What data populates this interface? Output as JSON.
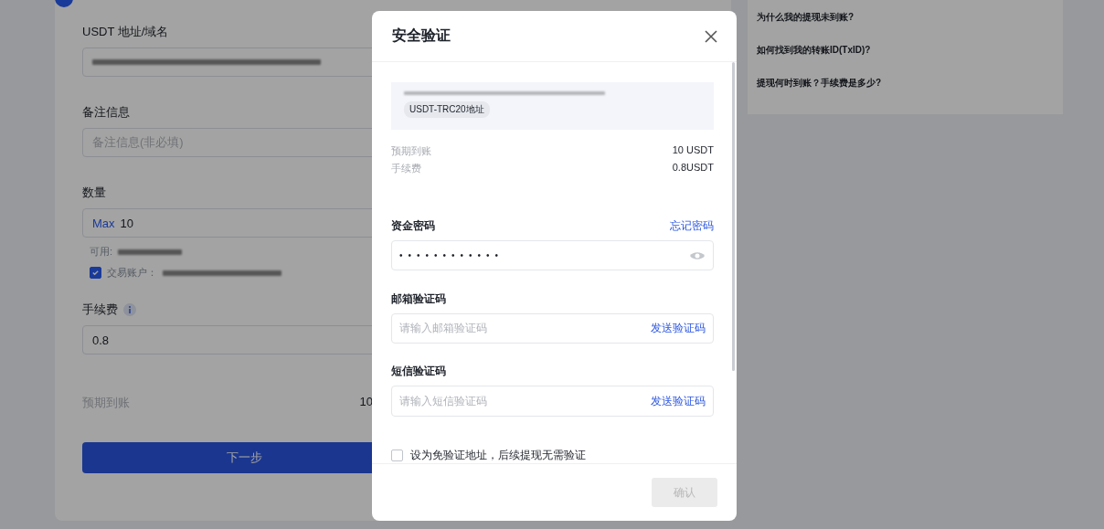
{
  "form": {
    "address": {
      "label": "USDT 地址/域名"
    },
    "memo": {
      "label": "备注信息",
      "placeholder": "备注信息(非必填)"
    },
    "amount": {
      "label": "数量",
      "max": "Max",
      "value": "10",
      "available_label": "可用:"
    },
    "account": {
      "label": "交易账户：",
      "checked": true
    },
    "fee": {
      "label": "手续费",
      "value": "0.8"
    },
    "expected": {
      "label": "预期到账",
      "value": "10"
    },
    "next_button": "下一步"
  },
  "faq": [
    "为什么我的提现未到账?",
    "如何找到我的转账ID(TxID)?",
    "提现何时到账？手续费是多少?"
  ],
  "modal": {
    "title": "安全验证",
    "address_tag": "USDT-TRC20地址",
    "summary": [
      {
        "label": "预期到账",
        "value": "10 USDT"
      },
      {
        "label": "手续费",
        "value": "0.8USDT"
      }
    ],
    "password": {
      "label": "资金密码",
      "link": "忘记密码",
      "value": "••••••••••••"
    },
    "codes": [
      {
        "label": "邮箱验证码",
        "placeholder": "请输入邮箱验证码",
        "action": "发送验证码"
      },
      {
        "label": "短信验证码",
        "placeholder": "请输入短信验证码",
        "action": "发送验证码"
      }
    ],
    "whitelist": {
      "label": "设为免验证地址，后续提现无需验证",
      "checked": false
    },
    "confirm": {
      "label": "确认",
      "disabled": true
    }
  }
}
